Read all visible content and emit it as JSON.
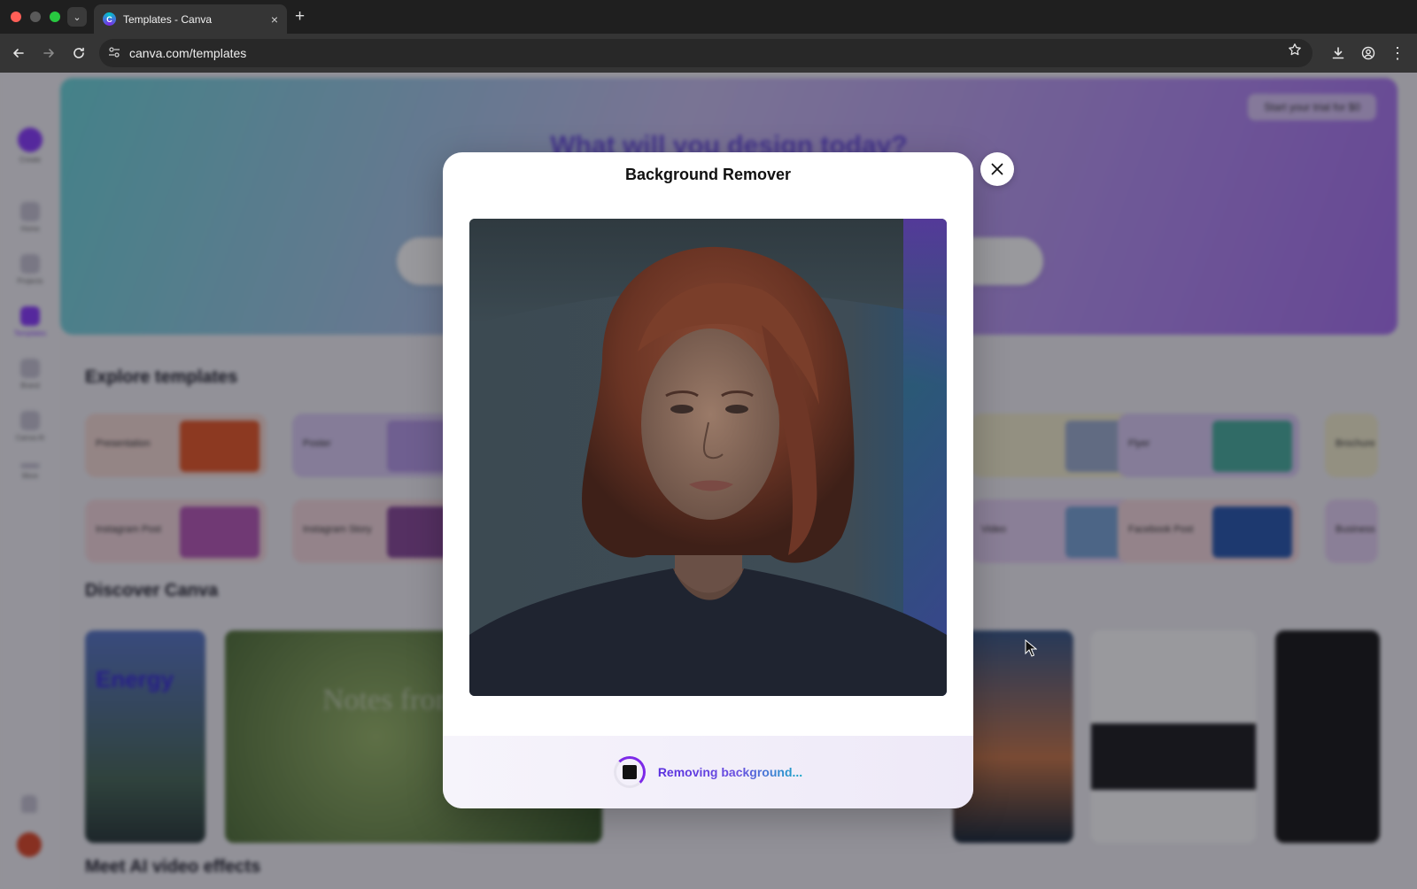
{
  "browser": {
    "tab_title": "Templates - Canva",
    "tab_favicon_letter": "C",
    "url": "canva.com/templates",
    "new_tab_glyph": "+",
    "tab_close_glyph": "×"
  },
  "background_page": {
    "hero_title": "What will you design today?",
    "trial_button": "Start your trial for $0",
    "sidebar_items": [
      "Create",
      "Home",
      "Projects",
      "Templates",
      "Brand",
      "Canva AI",
      "More"
    ],
    "explore_title": "Explore templates",
    "template_cards": [
      "Presentation",
      "Poster",
      "",
      "",
      "Flyer",
      "Brochure",
      "Instagram Post",
      "Instagram Story",
      "",
      "Video",
      "Facebook Post",
      "Business"
    ],
    "discover_title": "Discover Canva",
    "discover_card_text": [
      "Energy",
      "Notes from Life in Pro"
    ],
    "ai_section_title": "Meet AI video effects"
  },
  "modal": {
    "title": "Background Remover",
    "status_text": "Removing background...",
    "progress_state": "in-progress"
  },
  "colors": {
    "brand_purple": "#7d2ae8",
    "status_gradient_start": "#5a2fe0",
    "status_gradient_end": "#18a8c8"
  },
  "icons": {
    "back": "arrow-left-icon",
    "forward": "arrow-right-icon",
    "reload": "reload-icon",
    "site_info": "tune-icon",
    "bookmark": "star-icon",
    "download": "download-icon",
    "profile": "profile-icon",
    "menu": "more-vertical-icon",
    "close": "close-icon",
    "stop": "stop-icon"
  }
}
